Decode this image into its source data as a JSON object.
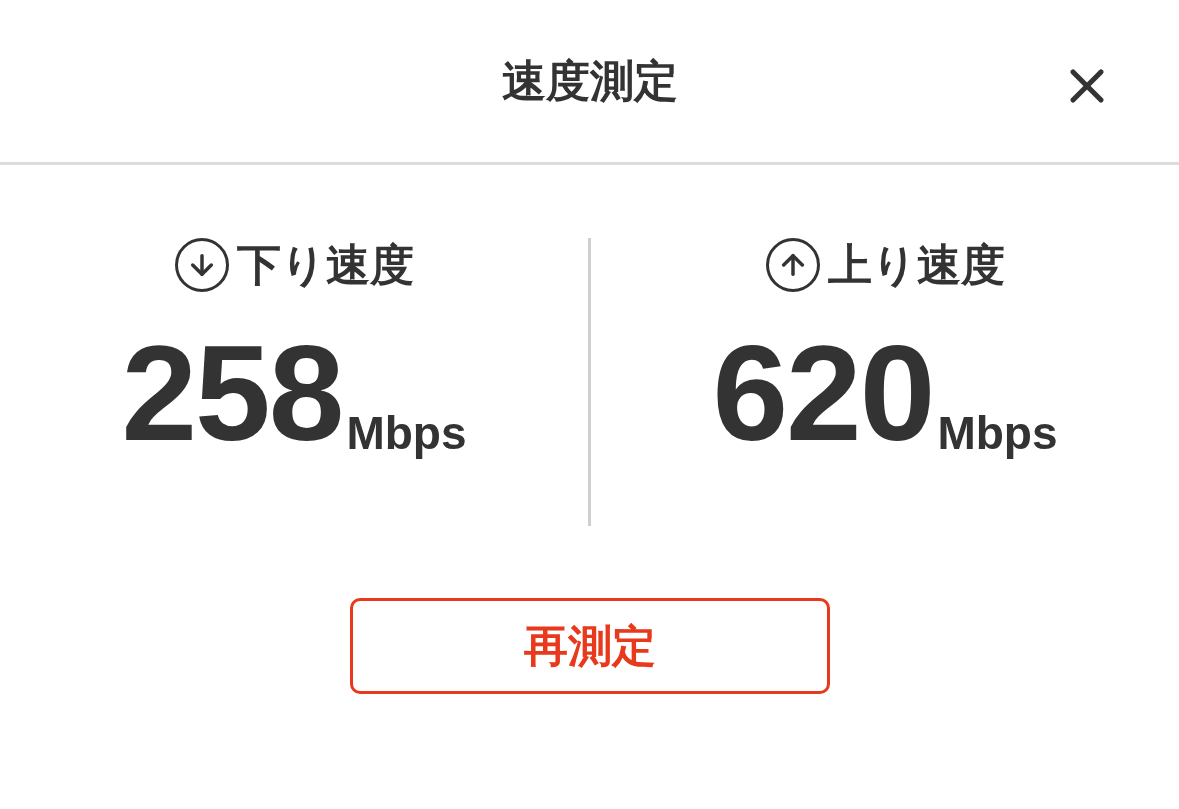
{
  "header": {
    "title": "速度測定"
  },
  "metrics": [
    {
      "kind": "download",
      "label": "下り速度",
      "value": "258",
      "unit": "Mbps"
    },
    {
      "kind": "upload",
      "label": "上り速度",
      "value": "620",
      "unit": "Mbps"
    }
  ],
  "retest_button": {
    "label": "再測定"
  }
}
